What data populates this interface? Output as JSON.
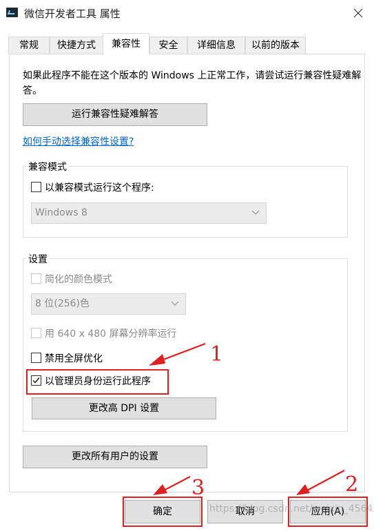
{
  "window": {
    "title": "微信开发者工具 属性"
  },
  "tabs": [
    {
      "label": "常规"
    },
    {
      "label": "快捷方式"
    },
    {
      "label": "兼容性",
      "active": true
    },
    {
      "label": "安全"
    },
    {
      "label": "详细信息"
    },
    {
      "label": "以前的版本"
    }
  ],
  "compat": {
    "description": "如果此程序不能在这个版本的 Windows 上正常工作，请尝试运行兼容性疑难解答。",
    "troubleshoot_button": "运行兼容性疑难解答",
    "manual_link": "如何手动选择兼容性设置?",
    "mode_group": {
      "label": "兼容模式",
      "checkbox_label": "以兼容模式运行这个程序:",
      "checked": false,
      "os_select": "Windows 8"
    },
    "settings_group": {
      "label": "设置",
      "reduced_color": {
        "label": "简化的颜色模式",
        "checked": false,
        "disabled": true
      },
      "color_select": "8 位(256)色",
      "res_640": {
        "label": "用 640 x 480 屏幕分辨率运行",
        "checked": false,
        "disabled": true
      },
      "disable_fullscreen": {
        "label": "禁用全屏优化",
        "checked": false
      },
      "run_as_admin": {
        "label": "以管理员身份运行此程序",
        "checked": true
      },
      "dpi_button": "更改高 DPI 设置"
    },
    "all_users_button": "更改所有用户的设置"
  },
  "footer": {
    "ok_button": "确定",
    "cancel_button": "取消",
    "apply_button": "应用(A)"
  },
  "annotations": {
    "marker_1": "1",
    "marker_2": "2",
    "marker_3": "3",
    "color": "#e02020"
  },
  "watermark": "https://blog.csdn.net/weixin_45642683"
}
